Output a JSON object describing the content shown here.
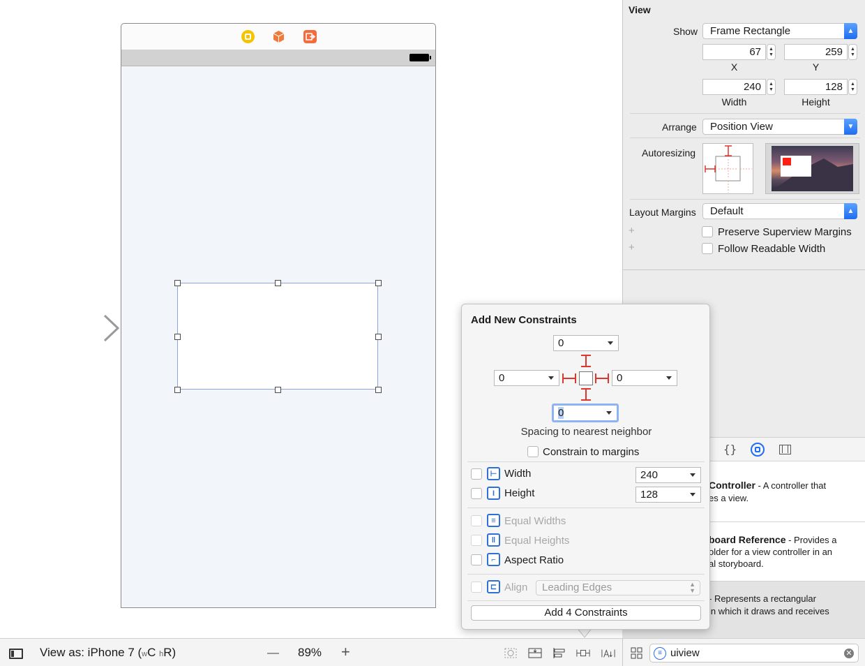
{
  "canvas": {
    "dock_icons": [
      "view-controller-icon",
      "first-responder-icon",
      "exit-icon"
    ],
    "handle_count": 8
  },
  "bottom_bar": {
    "view_as_label": "View as: iPhone 7 (",
    "w_label": "w",
    "c_label": "C",
    "h_label": "h",
    "r_label": "R)",
    "zoom_out": "—",
    "zoom_level": "89%",
    "zoom_in": "+"
  },
  "inspector": {
    "section_title": "View",
    "show_label": "Show",
    "show_value": "Frame Rectangle",
    "x_value": "67",
    "x_label": "X",
    "y_value": "259",
    "y_label": "Y",
    "width_value": "240",
    "width_label": "Width",
    "height_value": "128",
    "height_label": "Height",
    "arrange_label": "Arrange",
    "arrange_value": "Position View",
    "autoresizing_label": "Autoresizing",
    "layout_margins_label": "Layout Margins",
    "layout_margins_value": "Default",
    "preserve_label": "Preserve Superview Margins",
    "readable_label": "Follow Readable Width"
  },
  "library": {
    "tab_icons": [
      "braces-icon",
      "object-library-icon",
      "media-library-icon"
    ],
    "items": [
      {
        "title": "Controller",
        "desc_1": " - A controller that",
        "desc_2": "es a view."
      },
      {
        "title": "board Reference",
        "desc_1": " - Provides a",
        "desc_2": "older for a view controller in an",
        "desc_3": "al storyboard."
      },
      {
        "title": "",
        "desc_1": "- Represents a rectangular",
        "desc_2": "in which it draws and receives"
      }
    ],
    "search_value": "uiview"
  },
  "popover": {
    "title": "Add New Constraints",
    "top_value": "0",
    "left_value": "0",
    "right_value": "0",
    "bottom_value": "0",
    "spacing_label": "Spacing to nearest neighbor",
    "constrain_margins_label": "Constrain to margins",
    "width_label": "Width",
    "width_value": "240",
    "height_label": "Height",
    "height_value": "128",
    "equal_widths_label": "Equal Widths",
    "equal_heights_label": "Equal Heights",
    "aspect_ratio_label": "Aspect Ratio",
    "align_label": "Align",
    "align_value": "Leading Edges",
    "add_button_label": "Add 4 Constraints"
  },
  "colors": {
    "accent_blue": "#1f6df0",
    "constraint_red": "#e0342f",
    "selection_border": "#8ea3e0"
  }
}
